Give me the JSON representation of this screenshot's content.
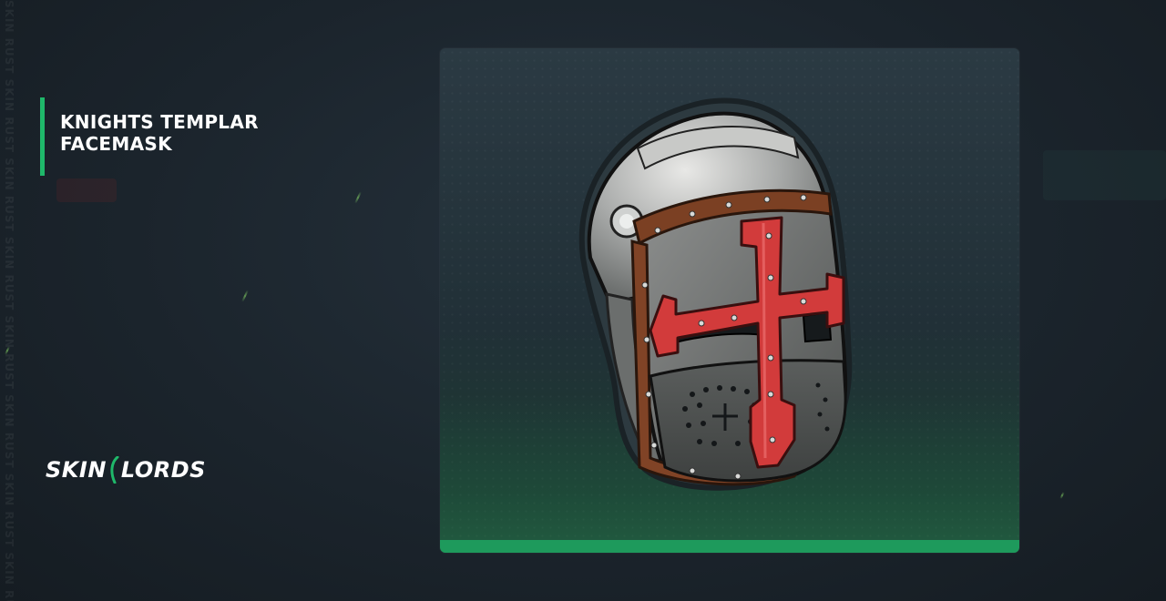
{
  "item": {
    "title": "KNIGHTS TEMPLAR FACEMASK",
    "image_icon": "knights-templar-helmet-icon",
    "rarity_color": "#1e9a5c"
  },
  "brand": {
    "part1": "SKIN",
    "part2": "LORDS"
  },
  "watermark": {
    "text": "SKIN RUST SKIN RUST SKIN RUST SKIN RUST SKIN RUST SKIN RUST SKIN RUST SKIN RUST"
  },
  "colors": {
    "accent": "#1fb86a",
    "background": "#1b242c",
    "card": "#25343c"
  }
}
